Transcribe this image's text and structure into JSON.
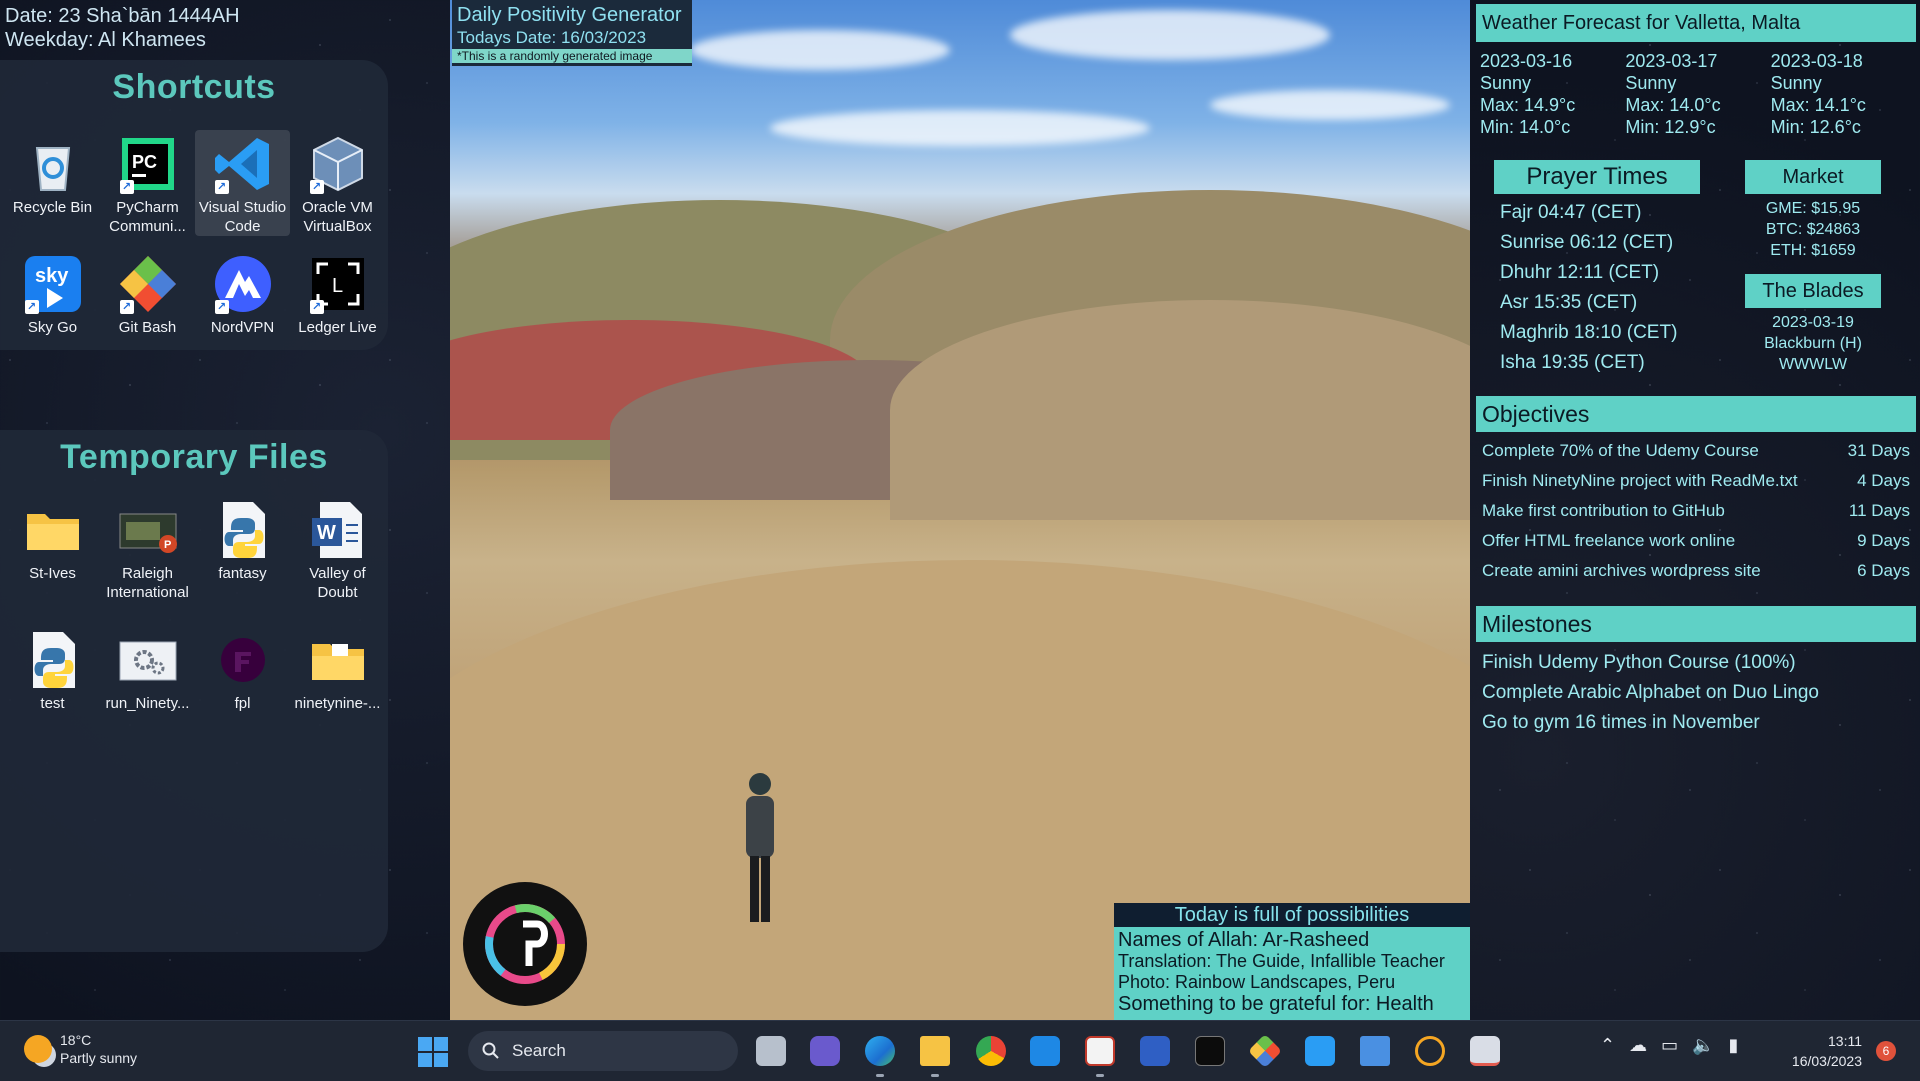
{
  "desktop_date": {
    "line1": "Date: 23 Sha`bān 1444AH",
    "line2": "Weekday: Al Khamees"
  },
  "shortcuts": {
    "title": "Shortcuts",
    "items": [
      {
        "label": "Recycle Bin",
        "icon": "recycle-bin-icon"
      },
      {
        "label": "PyCharm Communi...",
        "icon": "pycharm-icon"
      },
      {
        "label": "Visual Studio Code",
        "icon": "vscode-icon"
      },
      {
        "label": "Oracle VM VirtualBox",
        "icon": "virtualbox-icon"
      },
      {
        "label": "Sky Go",
        "icon": "sky-go-icon"
      },
      {
        "label": "Git Bash",
        "icon": "git-bash-icon"
      },
      {
        "label": "NordVPN",
        "icon": "nordvpn-icon"
      },
      {
        "label": "Ledger Live",
        "icon": "ledger-live-icon"
      }
    ]
  },
  "temp_files": {
    "title": "Temporary Files",
    "items": [
      {
        "label": "St-Ives",
        "icon": "folder-icon"
      },
      {
        "label": "Raleigh International",
        "icon": "powerpoint-file-icon"
      },
      {
        "label": "fantasy",
        "icon": "python-file-icon"
      },
      {
        "label": "Valley of Doubt",
        "icon": "word-file-icon"
      },
      {
        "label": "test",
        "icon": "python-file-icon"
      },
      {
        "label": "run_Ninety...",
        "icon": "settings-file-icon"
      },
      {
        "label": "fpl",
        "icon": "fpl-icon"
      },
      {
        "label": "ninetynine-...",
        "icon": "folder-icon"
      }
    ]
  },
  "positivity": {
    "title": "Daily Positivity Generator",
    "date": "Todays Date: 16/03/2023",
    "note": "*This is a randomly generated image"
  },
  "possibilities": {
    "heading": "Today is full of possibilities",
    "name": "Names of Allah: Ar-Rasheed",
    "translation": "Translation: The Guide, Infallible Teacher",
    "photo": "Photo: Rainbow Landscapes, Peru",
    "grateful": "Something to be grateful for: Health"
  },
  "weather": {
    "title": "Weather Forecast for Valletta, Malta",
    "days": [
      {
        "date": "2023-03-16",
        "cond": "Sunny",
        "max": "Max: 14.9°c",
        "min": "Min: 14.0°c"
      },
      {
        "date": "2023-03-17",
        "cond": "Sunny",
        "max": "Max: 14.0°c",
        "min": "Min: 12.9°c"
      },
      {
        "date": "2023-03-18",
        "cond": "Sunny",
        "max": "Max: 14.1°c",
        "min": "Min: 12.6°c"
      }
    ]
  },
  "prayer": {
    "title": "Prayer Times",
    "times": [
      "Fajr 04:47 (CET)",
      "Sunrise 06:12 (CET)",
      "Dhuhr 12:11 (CET)",
      "Asr 15:35 (CET)",
      "Maghrib 18:10 (CET)",
      "Isha 19:35 (CET)"
    ]
  },
  "market": {
    "title": "Market",
    "rows": [
      "GME: $15.95",
      "BTC: $24863",
      "ETH: $1659"
    ]
  },
  "blades": {
    "title": "The Blades",
    "rows": [
      "2023-03-19",
      "Blackburn (H)",
      "WWWLW"
    ]
  },
  "objectives": {
    "title": "Objectives",
    "items": [
      {
        "text": "Complete 70% of the Udemy Course",
        "days": "31 Days"
      },
      {
        "text": "Finish NinetyNine project with ReadMe.txt",
        "days": "4 Days"
      },
      {
        "text": "Make first contribution to GitHub",
        "days": "11 Days"
      },
      {
        "text": "Offer HTML freelance work online",
        "days": "9 Days"
      },
      {
        "text": "Create amini archives wordpress site",
        "days": "6 Days"
      }
    ]
  },
  "milestones": {
    "title": "Milestones",
    "items": [
      "Finish Udemy Python Course (100%)",
      "Complete Arabic Alphabet on Duo Lingo",
      "Go to gym 16 times in November"
    ]
  },
  "taskbar": {
    "weather_temp": "18°C",
    "weather_desc": "Partly sunny",
    "search_label": "Search",
    "time": "13:11",
    "date": "16/03/2023",
    "notifications": "6"
  },
  "colors": {
    "accent_teal": "#5fd1c6",
    "text_cyan": "#9feaf0",
    "panel_bg": "#1f2837"
  }
}
